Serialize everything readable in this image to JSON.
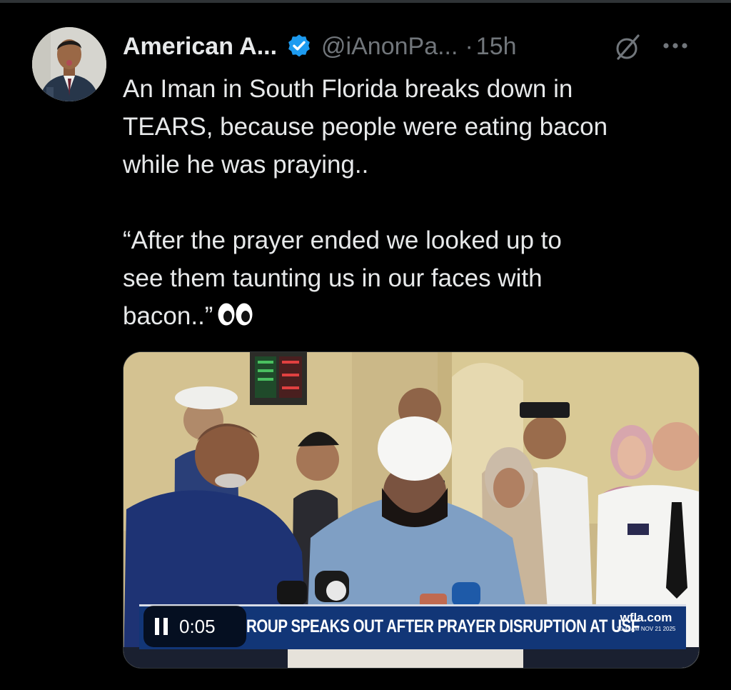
{
  "tweet": {
    "author_name": "American A...",
    "handle": "@iAnonPa...",
    "separator": "·",
    "timestamp": "15h",
    "text": "An Iman in South Florida breaks down in\nTEARS, because people were eating bacon\nwhile he was praying..\n\n“After the prayer ended we looked up to\nsee them taunting us in our faces with\nbacon..”"
  },
  "icons": {
    "verified": "verified-badge-icon",
    "grok": "grok-icon",
    "more": "more-icon",
    "eyes": "eyes-emoji-icon",
    "pause": "pause-icon"
  },
  "media": {
    "ticker": "ROUP SPEAKS OUT AFTER PRAYER DISRUPTION AT USF",
    "station_logo": "wfla.com",
    "station_time": "10:42AM NOV 21 2025",
    "video_time": "0:05"
  },
  "colors": {
    "background": "#000000",
    "primary_text": "#e7e9ea",
    "secondary_text": "#71767b",
    "verified_blue": "#1d9bf0",
    "ticker_blue": "#123677"
  }
}
